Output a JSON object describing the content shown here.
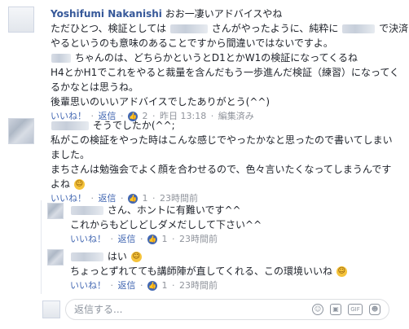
{
  "comments": [
    {
      "author": "Yoshifumi Nakanishi",
      "lines": [
        "おお一凄いアドバイスやね",
        "ただひとつ、検証としては",
        "さんがやったように、純粋に",
        "で決済で",
        "やるというのも意味のあることですから間違いではないですよ。",
        "ちゃんのは、どちらかというとD1とかW1の検証になってくるね",
        "H4とかH1でこれをやると裁量を含んだもう一歩進んだ検証（練習）になってく",
        "るかなとは思うね。",
        "後輩思いのいいアドバイスでしたありがとう(^^)"
      ],
      "actions": {
        "like": "いいね！",
        "reply": "返信",
        "count": "2",
        "time": "昨日 13:18",
        "edited": "編集済み"
      }
    },
    {
      "author_suffix": "そうでしたか(^^;",
      "lines": [
        "私がこの検証をやった時はこんな感じでやったかなと思ったので書いてしまい",
        "ました。",
        "まちさんは勉強会でよく顔を合わせるので、色々言いたくなってしまうんです",
        "よね"
      ],
      "actions": {
        "like": "いいね！",
        "reply": "返信",
        "count": "1",
        "time": "23時間前"
      }
    },
    {
      "author_suffix": "さん、ホントに有難いです^^",
      "lines": [
        "これからもどしどしダメだしして下さい^^"
      ],
      "actions": {
        "like": "いいね！",
        "reply": "返信",
        "count": "1",
        "time": "23時間前"
      }
    },
    {
      "author_suffix": "はい",
      "lines": [
        "ちょっとずれてても講師陣が直してくれる、この環境いいね"
      ],
      "actions": {
        "like": "いいね！",
        "reply": "返信",
        "count": "1",
        "time": "23時間前"
      }
    }
  ],
  "composer": {
    "placeholder": "返信する..."
  },
  "icons": {
    "like": "thumbs-up-icon",
    "emoji": "grinning-face-icon",
    "smile": "smile-icon",
    "camera": "camera-icon",
    "gif": "gif-icon",
    "sticker": "sticker-icon"
  },
  "colors": {
    "author": "#365899",
    "link": "#4267b2",
    "meta": "#90949c",
    "like_badge": "#4267b2",
    "emoji": "#f5c33b"
  }
}
